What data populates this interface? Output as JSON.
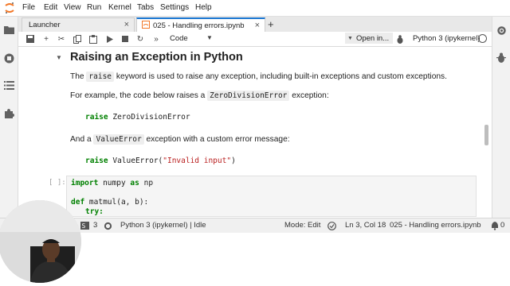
{
  "menubar": {
    "items": [
      "File",
      "Edit",
      "View",
      "Run",
      "Kernel",
      "Tabs",
      "Settings",
      "Help"
    ]
  },
  "tabs": [
    {
      "label": "Launcher",
      "active": false
    },
    {
      "label": "025 - Handling errors.ipynb",
      "active": true
    }
  ],
  "toolbar": {
    "cell_type": "Code",
    "open_in": "Open in...",
    "kernel": "Python 3 (ipykernel)"
  },
  "notebook": {
    "heading": "Raising an Exception in Python",
    "p1_before": "The",
    "p1_code": "raise",
    "p1_after": "keyword is used to raise any exception, including built-in exceptions and custom exceptions.",
    "p2_before": "For example, the code below raises a",
    "p2_code": "ZeroDivisionError",
    "p2_after": "exception:",
    "code1_kw": "raise",
    "code1_rest": "ZeroDivisionError",
    "p3_before": "And a",
    "p3_code": "ValueError",
    "p3_after": "exception with a custom error message:",
    "code2_kw": "raise",
    "code2_mid": "ValueError(",
    "code2_str": "\"Invalid input\"",
    "code2_end": ")",
    "prompt": "[ ]:",
    "cell_line1_kw1": "import",
    "cell_line1_mid": "numpy",
    "cell_line1_kw2": "as",
    "cell_line1_end": "np",
    "cell_line2_kw": "def",
    "cell_line2_rest": "matmul(a, b):",
    "cell_line3_kw": "try:"
  },
  "statusbar": {
    "simple_mode_count": "3",
    "kernel_status": "Python 3 (ipykernel) | Idle",
    "mode": "Mode: Edit",
    "position": "Ln 3, Col 18",
    "file": "025 - Handling errors.ipynb",
    "notifications_count": "0"
  },
  "colors": {
    "accent": "#1976d2",
    "keyword": "#008000",
    "string": "#ba2121"
  }
}
